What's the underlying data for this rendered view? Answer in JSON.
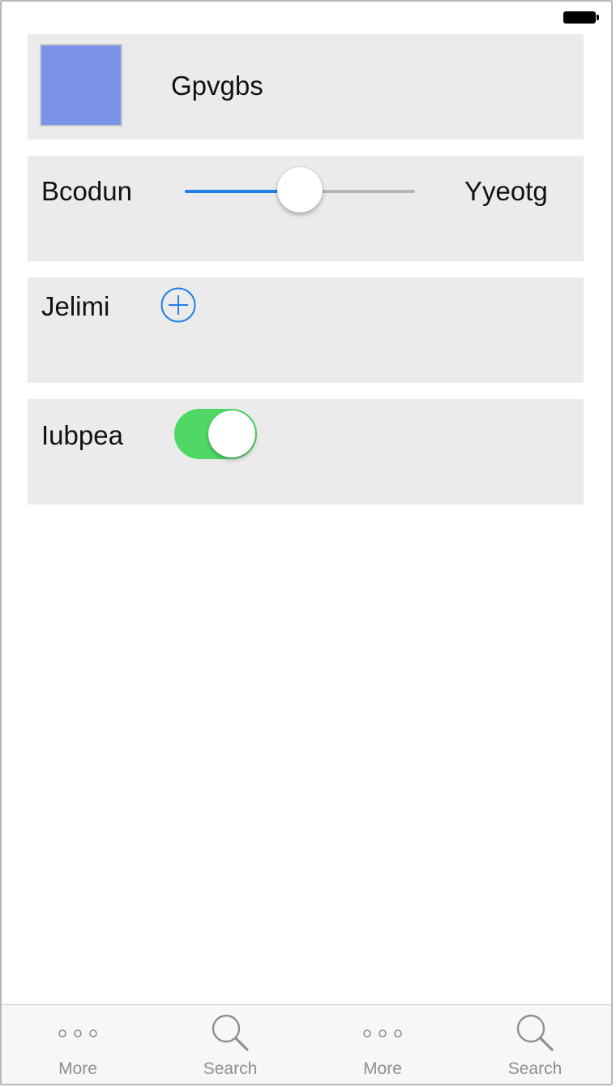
{
  "rows": {
    "color_row": {
      "label": "Gpvgbs",
      "swatch_color": "#7a93e8"
    },
    "slider_row": {
      "left_label": "Bcodun",
      "right_label": "Yyeotg",
      "value": 0.5,
      "accent": "#1f7ee8"
    },
    "add_row": {
      "label": "Jelimi",
      "icon": "plus-circle-icon"
    },
    "toggle_row": {
      "label": "Iubpea",
      "on": true,
      "on_color": "#4fd964"
    }
  },
  "tabbar": {
    "tabs": [
      {
        "label": "More",
        "icon": "more-icon"
      },
      {
        "label": "Search",
        "icon": "search-icon"
      },
      {
        "label": "More",
        "icon": "more-icon"
      },
      {
        "label": "Search",
        "icon": "search-icon"
      }
    ]
  }
}
